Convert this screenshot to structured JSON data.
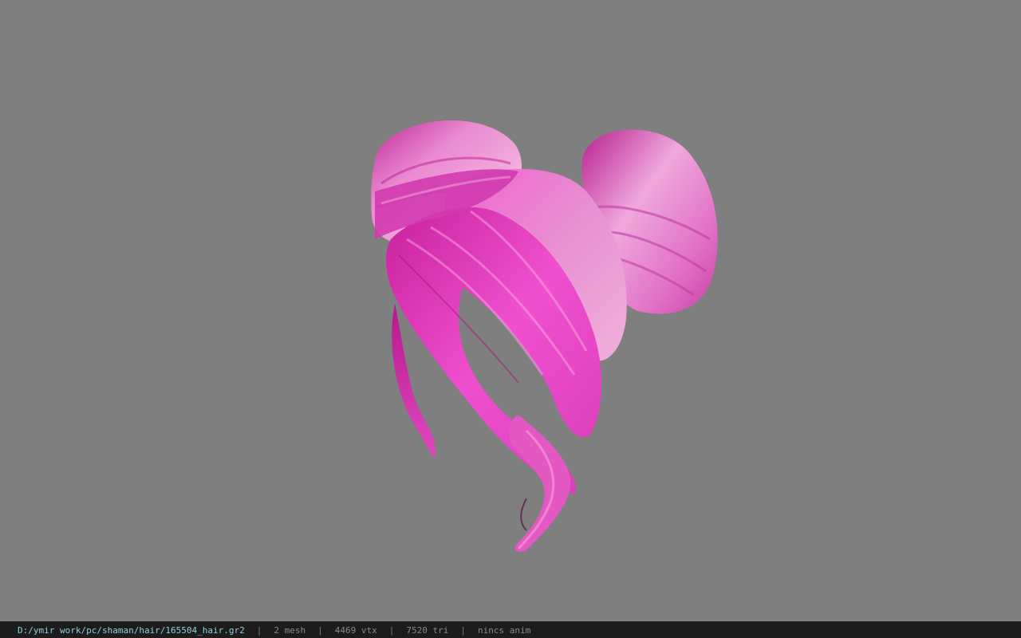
{
  "viewer": {
    "background_color": "#7f7f7f",
    "model_color": "#e040c0",
    "model_subject": "pink hair mesh with double buns and curled side strands"
  },
  "statusbar": {
    "file_path": "D:/ymir work/pc/shaman/hair/165504_hair.gr2",
    "separator": "|",
    "mesh_count": "2 mesh",
    "vertex_count": "4469 vtx",
    "triangle_count": "7520 tri",
    "anim_status": "nincs anim"
  }
}
